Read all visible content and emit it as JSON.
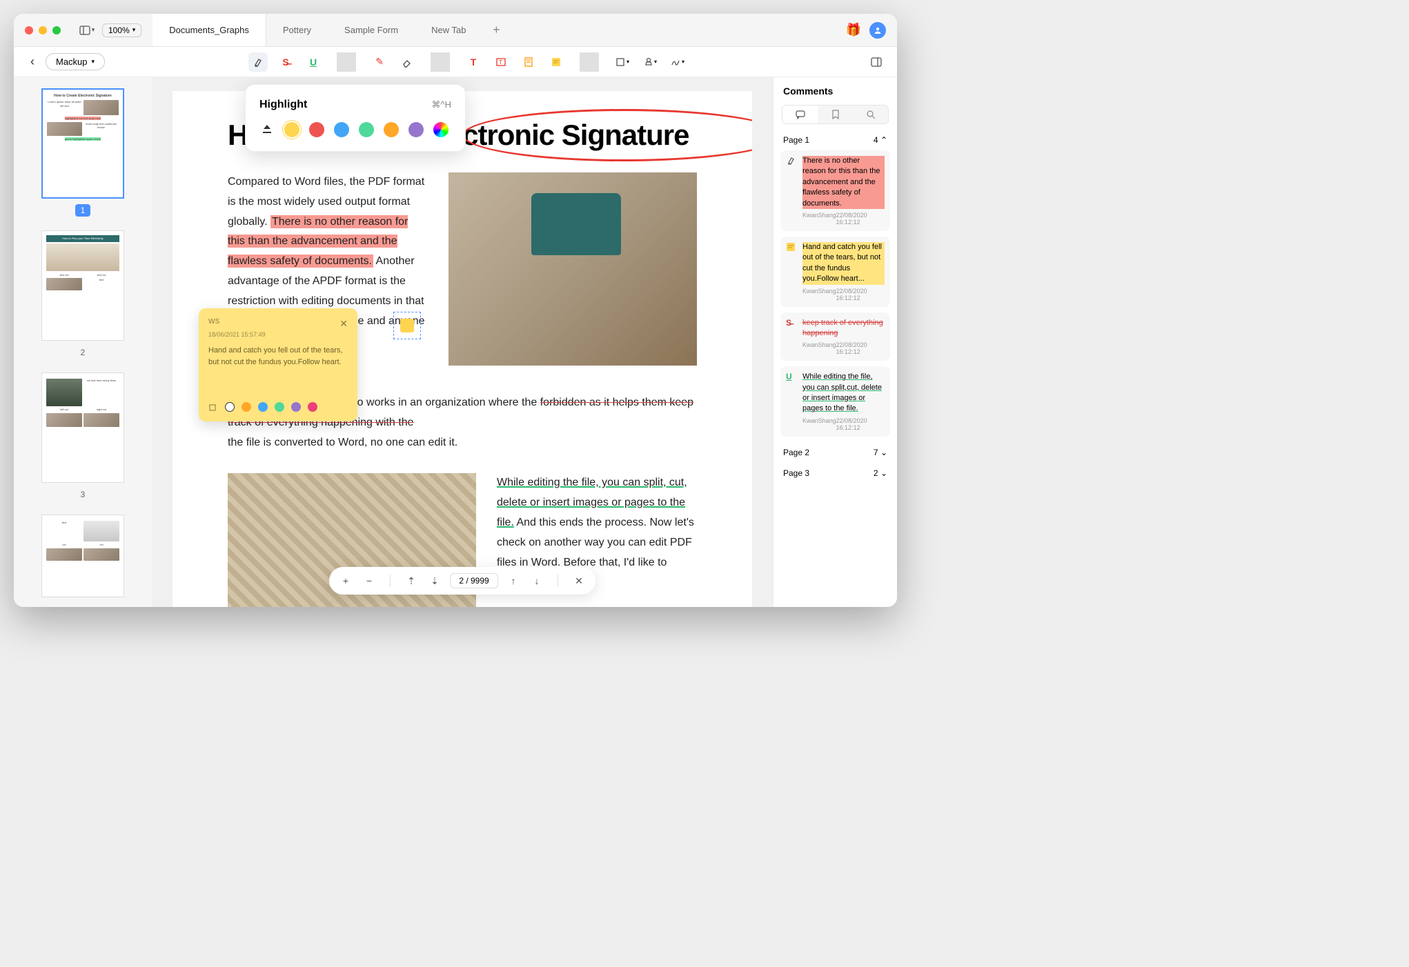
{
  "titlebar": {
    "zoom": "100%"
  },
  "tabs": [
    "Documents_Graphs",
    "Pottery",
    "Sample Form",
    "New Tab"
  ],
  "toolbar": {
    "mode": "Mackup"
  },
  "thumbnails": [
    {
      "num": "1",
      "active": true
    },
    {
      "num": "2",
      "active": false
    },
    {
      "num": "3",
      "active": false
    }
  ],
  "page": {
    "title": "How to Create Electronic Signature",
    "para1_a": "Compared to Word files, the PDF format is the most widely used output format globally. ",
    "para1_hl": "There is no other reason for this than the advancement and the flawless safety of documents.",
    "para1_b": " Another advantage of the APDF format is the restriction with editing documents in that format. While editing the file and anyone trying",
    "para2_a": "commended to anyone who works in an organization where the ",
    "para2_strike": "forbidden as it helps them keep track of everything happening with the",
    "para2_b": " the file is converted to Word, no one can edit it.",
    "para3_u": "While editing the file, you can split, cut, delete or insert images or pages to the file.",
    "para3_b": " And this ends the process. Now let's check on another way you can edit PDF files in Word. Before that, I'd like to answer a question"
  },
  "highlight_popup": {
    "title": "Highlight",
    "shortcut": "⌘^H"
  },
  "sticky_note": {
    "author": "WS",
    "timestamp": "18/06/2021 15:57:49",
    "body": "Hand and catch you fell out of the tears, but not cut the fundus you.Follow heart."
  },
  "comments_panel": {
    "title": "Comments",
    "sections": [
      {
        "label": "Page 1",
        "count": "4",
        "expanded": true
      },
      {
        "label": "Page 2",
        "count": "7",
        "expanded": false
      },
      {
        "label": "Page 3",
        "count": "2",
        "expanded": false
      }
    ],
    "items": [
      {
        "kind": "highlight-red",
        "text": "There is no other reason for this than the advancement and the flawless safety of documents.",
        "author": "KwanShang",
        "time": "22/08/2020 16:12:12"
      },
      {
        "kind": "note-yellow",
        "text": "Hand and catch you fell out of the tears, but not cut the fundus you.Follow heart...",
        "author": "KwanShang",
        "time": "22/08/2020 16:12:12"
      },
      {
        "kind": "strike",
        "text": "keep track of everything happening",
        "author": "KwanShang",
        "time": "22/08/2020 16:12:12"
      },
      {
        "kind": "underline",
        "text": "While editing the file, you can split,cut, delete or insert images or pages to the file.",
        "author": "KwanShang",
        "time": "22/08/2020 16:12:12"
      }
    ]
  },
  "pagenav": {
    "current": "2 / 9999"
  }
}
